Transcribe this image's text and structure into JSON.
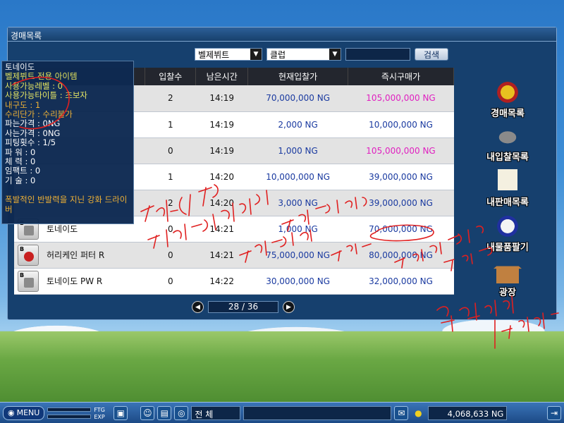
{
  "window": {
    "title": "경매목록"
  },
  "filters": {
    "category": "벨제뷔트",
    "type": "클럽",
    "search_button": "검색"
  },
  "table": {
    "headers": [
      "입찰수",
      "남은시간",
      "현재입찰가",
      "즉시구매가"
    ],
    "rows": [
      {
        "name": "",
        "bids": "2",
        "time": "14:19",
        "current": "70,000,000 NG",
        "buyout": "105,000,000 NG",
        "buyout_color": "#e020c0"
      },
      {
        "name": "",
        "bids": "1",
        "time": "14:19",
        "current": "2,000 NG",
        "buyout": "10,000,000 NG",
        "buyout_color": "#1a3aa0"
      },
      {
        "name": "",
        "bids": "0",
        "time": "14:19",
        "current": "1,000 NG",
        "buyout": "105,000,000 NG",
        "buyout_color": "#e020c0"
      },
      {
        "name": "",
        "bids": "1",
        "time": "14:20",
        "current": "10,000,000 NG",
        "buyout": "39,000,000 NG",
        "buyout_color": "#1a3aa0"
      },
      {
        "name": "",
        "bids": "2",
        "time": "14:20",
        "current": "3,000 NG",
        "buyout": "39,000,000 NG",
        "buyout_color": "#1a3aa0"
      },
      {
        "name": "토네이도",
        "bids": "0",
        "time": "14:21",
        "current": "1,000 NG",
        "buyout": "70,000,000 NG",
        "buyout_color": "#1a3aa0"
      },
      {
        "name": "허리케인 퍼터 R",
        "bids": "0",
        "time": "14:21",
        "current": "75,000,000 NG",
        "buyout": "80,000,000 NG",
        "buyout_color": "#1a3aa0"
      },
      {
        "name": "토네이도 PW R",
        "bids": "0",
        "time": "14:22",
        "current": "30,000,000 NG",
        "buyout": "32,000,000 NG",
        "buyout_color": "#1a3aa0"
      }
    ]
  },
  "pager": {
    "text": "28 / 36"
  },
  "side_menu": [
    "경매목록",
    "내입찰목록",
    "내판매목록",
    "내물품팔기",
    "광장"
  ],
  "tooltip": {
    "name": "토네이도",
    "lines": [
      {
        "text": "벨제뷔트 전용 아이템",
        "tone": "y"
      },
      {
        "text": "사용가능레벨 : 0",
        "tone": "y"
      },
      {
        "text": "사용가능타이틀 : 초보자",
        "tone": "y"
      },
      {
        "text": "내구도 : 1",
        "tone": "o"
      },
      {
        "text": "수리단가 : 수리불가",
        "tone": "o"
      },
      {
        "text": "파는가격 : 0NG",
        "tone": "w"
      },
      {
        "text": "사는가격 : 0NG",
        "tone": "w"
      },
      {
        "text": "피팅횟수 : 1/5",
        "tone": "w"
      },
      {
        "text": "파   워 : 0",
        "tone": "w"
      },
      {
        "text": "체   력 : 0",
        "tone": "w"
      },
      {
        "text": "임팩트 : 0",
        "tone": "w"
      },
      {
        "text": "기   술 : 0",
        "tone": "w"
      }
    ],
    "desc": "폭발적인 반발력을 지닌 강화 드라이버"
  },
  "taskbar": {
    "menu": "MENU",
    "ftg": "FTG",
    "exp": "EXP",
    "chat_channel": "전 체",
    "money": "4,068,633 NG"
  },
  "colors": {
    "window_bg": "#16406e",
    "header_bg": "#23262e",
    "buyout_pink": "#e020c0",
    "price_blue": "#1a3aa0"
  }
}
